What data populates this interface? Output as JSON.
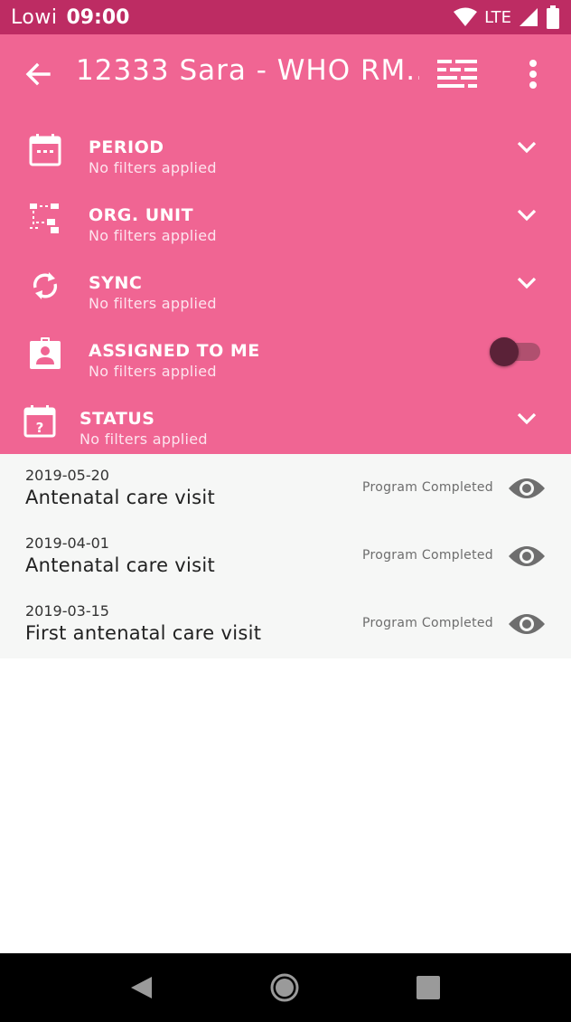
{
  "status_bar": {
    "carrier": "Lowi",
    "time": "09:00",
    "network": "LTE",
    "icons": [
      "wifi-icon",
      "signal-icon",
      "battery-icon"
    ]
  },
  "app_bar": {
    "title": "12333 Sara - WHO RM...",
    "icons": [
      "back-arrow-icon",
      "filter-list-icon",
      "more-vert-icon"
    ]
  },
  "filters": [
    {
      "label": "PERIOD",
      "sub": "No filters applied",
      "icon": "calendar-icon",
      "control": "chevron"
    },
    {
      "label": "ORG. UNIT",
      "sub": "No filters applied",
      "icon": "org-tree-icon",
      "control": "chevron"
    },
    {
      "label": "SYNC",
      "sub": "No filters applied",
      "icon": "sync-icon",
      "control": "chevron"
    },
    {
      "label": "ASSIGNED TO ME",
      "sub": "No filters applied",
      "icon": "assignment-ind-icon",
      "control": "toggle",
      "toggle_on": false
    },
    {
      "label": "STATUS",
      "sub": "No filters applied",
      "icon": "calendar-question-icon",
      "control": "chevron"
    }
  ],
  "events": [
    {
      "date": "2019-05-20",
      "name": "Antenatal care visit",
      "status": "Program Completed"
    },
    {
      "date": "2019-04-01",
      "name": "Antenatal care visit",
      "status": "Program Completed"
    },
    {
      "date": "2019-03-15",
      "name": "First antenatal care visit",
      "status": "Program Completed"
    }
  ],
  "colors": {
    "status_bar": "#bd2c63",
    "primary": "#f06593",
    "list_background": "#f6f7f6",
    "nav_bar": "#000000"
  }
}
